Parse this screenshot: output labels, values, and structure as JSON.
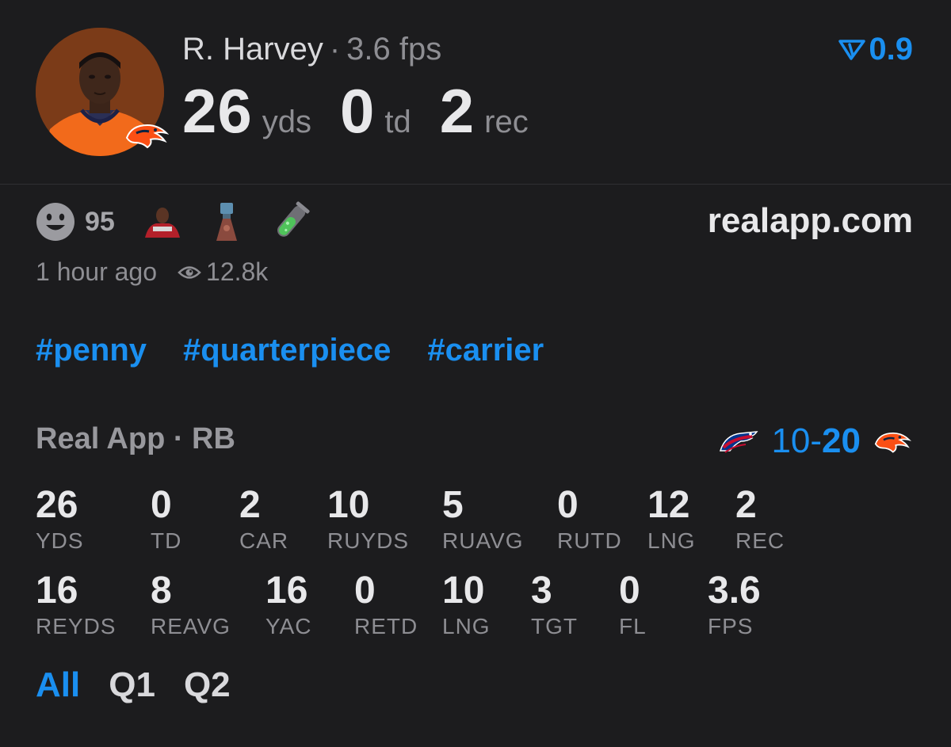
{
  "player": {
    "name": "R. Harvey",
    "separator": "·",
    "fps": "3.6 fps",
    "summary": [
      {
        "value": "26",
        "unit": "yds"
      },
      {
        "value": "0",
        "unit": "td"
      },
      {
        "value": "2",
        "unit": "rec"
      }
    ],
    "avatar_icon": "player-headshot",
    "team_icon": "broncos-logo"
  },
  "trend": {
    "icon": "trend-arrow-icon",
    "value": "0.9",
    "color": "#1a8ff0"
  },
  "reactions": {
    "smile_icon": "smiley-icon",
    "count": "95",
    "icons": [
      "player-emoji-icon",
      "statue-emoji-icon",
      "test-tube-icon"
    ]
  },
  "site": "realapp.com",
  "meta": {
    "time": "1 hour ago",
    "views_icon": "eye-icon",
    "views": "12.8k"
  },
  "tags": [
    "#penny",
    "#quarterpiece",
    "#carrier"
  ],
  "section": {
    "title": "Real App · RB"
  },
  "score": {
    "away_icon": "bills-logo",
    "away": "10",
    "dash": "-",
    "home": "20",
    "home_icon": "broncos-logo"
  },
  "stats": {
    "row1": [
      {
        "value": "26",
        "label": "YDS"
      },
      {
        "value": "0",
        "label": "TD"
      },
      {
        "value": "2",
        "label": "CAR"
      },
      {
        "value": "10",
        "label": "RUYDS"
      },
      {
        "value": "5",
        "label": "RUAVG"
      },
      {
        "value": "0",
        "label": "RUTD"
      },
      {
        "value": "12",
        "label": "LNG"
      },
      {
        "value": "2",
        "label": "REC"
      }
    ],
    "row2": [
      {
        "value": "16",
        "label": "REYDS"
      },
      {
        "value": "8",
        "label": "REAVG"
      },
      {
        "value": "16",
        "label": "YAC"
      },
      {
        "value": "0",
        "label": "RETD"
      },
      {
        "value": "10",
        "label": "LNG"
      },
      {
        "value": "3",
        "label": "TGT"
      },
      {
        "value": "0",
        "label": "FL"
      },
      {
        "value": "3.6",
        "label": "FPS"
      }
    ]
  },
  "tabs": [
    {
      "label": "All",
      "active": true
    },
    {
      "label": "Q1",
      "active": false
    },
    {
      "label": "Q2",
      "active": false
    }
  ],
  "colors": {
    "background": "#1c1c1e",
    "accent": "#1a8ff0",
    "primary_text": "#e8e8ea",
    "secondary_text": "#8e8e93",
    "broncos_orange": "#fb4f14"
  }
}
